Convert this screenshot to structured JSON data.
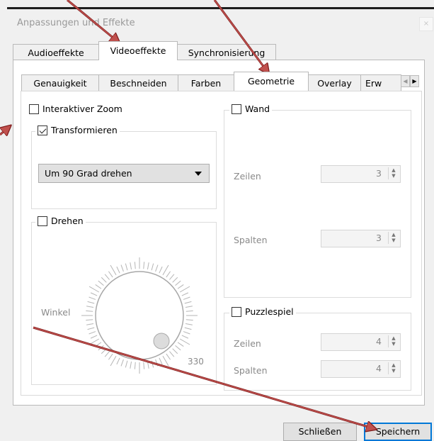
{
  "window": {
    "title": "Anpassungen und Effekte",
    "close_glyph": "×"
  },
  "main_tabs": [
    {
      "label": "Audioeffekte",
      "active": false
    },
    {
      "label": "Videoeffekte",
      "active": true
    },
    {
      "label": "Synchronisierung",
      "active": false
    }
  ],
  "sub_tabs": [
    {
      "label": "Genauigkeit",
      "active": false
    },
    {
      "label": "Beschneiden",
      "active": false
    },
    {
      "label": "Farben",
      "active": false
    },
    {
      "label": "Geometrie",
      "active": true
    },
    {
      "label": "Overlay",
      "active": false
    },
    {
      "label": "Erw",
      "active": false
    }
  ],
  "geometry": {
    "interactive_zoom": {
      "label": "Interaktiver Zoom",
      "checked": false
    },
    "transform": {
      "label": "Transformieren",
      "checked": true,
      "selected_option": "Um 90 Grad drehen"
    },
    "rotate": {
      "label": "Drehen",
      "checked": false,
      "angle_label": "Winkel",
      "angle_value": "330"
    },
    "wall": {
      "label": "Wand",
      "checked": false,
      "rows_label": "Zeilen",
      "rows_value": "3",
      "cols_label": "Spalten",
      "cols_value": "3"
    },
    "puzzle": {
      "label": "Puzzlespiel",
      "checked": false,
      "rows_label": "Zeilen",
      "rows_value": "4",
      "cols_label": "Spalten",
      "cols_value": "4"
    }
  },
  "footer": {
    "close_label": "Schließen",
    "save_label": "Speichern"
  },
  "colors": {
    "annotation_arrow": "#c0504d",
    "annotation_outline": "#7f1d1d",
    "focus_border": "#0078d7"
  }
}
